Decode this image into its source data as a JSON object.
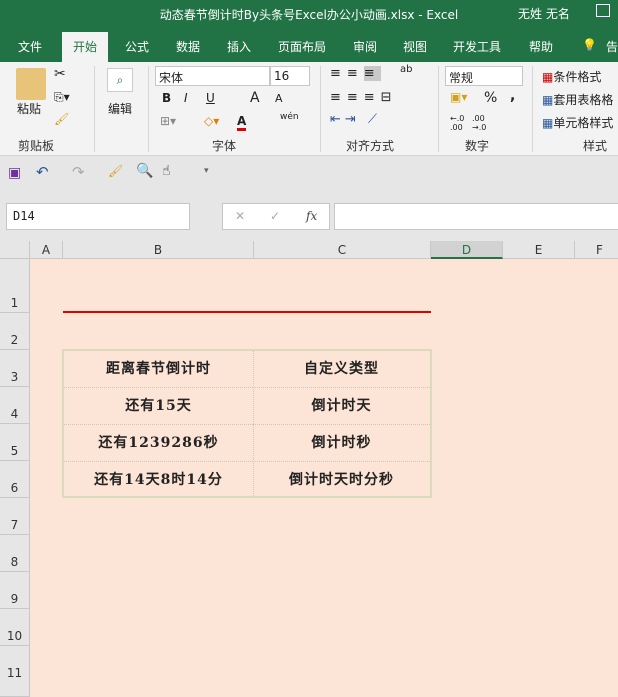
{
  "window": {
    "title": "动态春节倒计时By头条号Excel办公小动画.xlsx  -  Excel",
    "user": "无姓 无名"
  },
  "tabs": [
    "文件",
    "开始",
    "公式",
    "数据",
    "插入",
    "页面布局",
    "审阅",
    "视图",
    "开发工具",
    "帮助",
    "告"
  ],
  "ribbon": {
    "clipboard": {
      "paste": "粘贴",
      "label": "剪贴板"
    },
    "editing": {
      "label": "编辑"
    },
    "font": {
      "name": "宋体",
      "size": "16",
      "bold": "B",
      "italic": "I",
      "underline": "U",
      "grow": "A",
      "shrink": "A",
      "color": "A",
      "phonetic": "wén",
      "label": "字体",
      "font_color": "#e00000"
    },
    "alignment": {
      "label": "对齐方式",
      "wrap": "ab"
    },
    "number": {
      "format": "常规",
      "percent": "%",
      "comma": ",",
      "label": "数字",
      "inc": "←.0 .00",
      "dec": ".00 →.0"
    },
    "styles": {
      "conditional": "条件格式",
      "table": "套用表格格",
      "cell": "单元格样式",
      "label": "样式"
    }
  },
  "formula_bar": {
    "name_box": "D14",
    "cancel": "✕",
    "enter": "✓",
    "fx": "fx",
    "value": ""
  },
  "columns": [
    "A",
    "B",
    "C",
    "D",
    "E",
    "F"
  ],
  "rows": [
    "1",
    "2",
    "3",
    "4",
    "5",
    "6",
    "7",
    "8",
    "9",
    "10",
    "11"
  ],
  "table": [
    [
      "距离春节倒计时",
      "自定义类型"
    ],
    [
      "还有15天",
      "倒计时天"
    ],
    [
      "还有1239286秒",
      "倒计时秒"
    ],
    [
      "还有14天8时14分",
      "倒计时天时分秒"
    ]
  ],
  "colors": {
    "accent": "#217346",
    "sheet_bg": "#fce4d6",
    "red_line": "#e00000"
  }
}
